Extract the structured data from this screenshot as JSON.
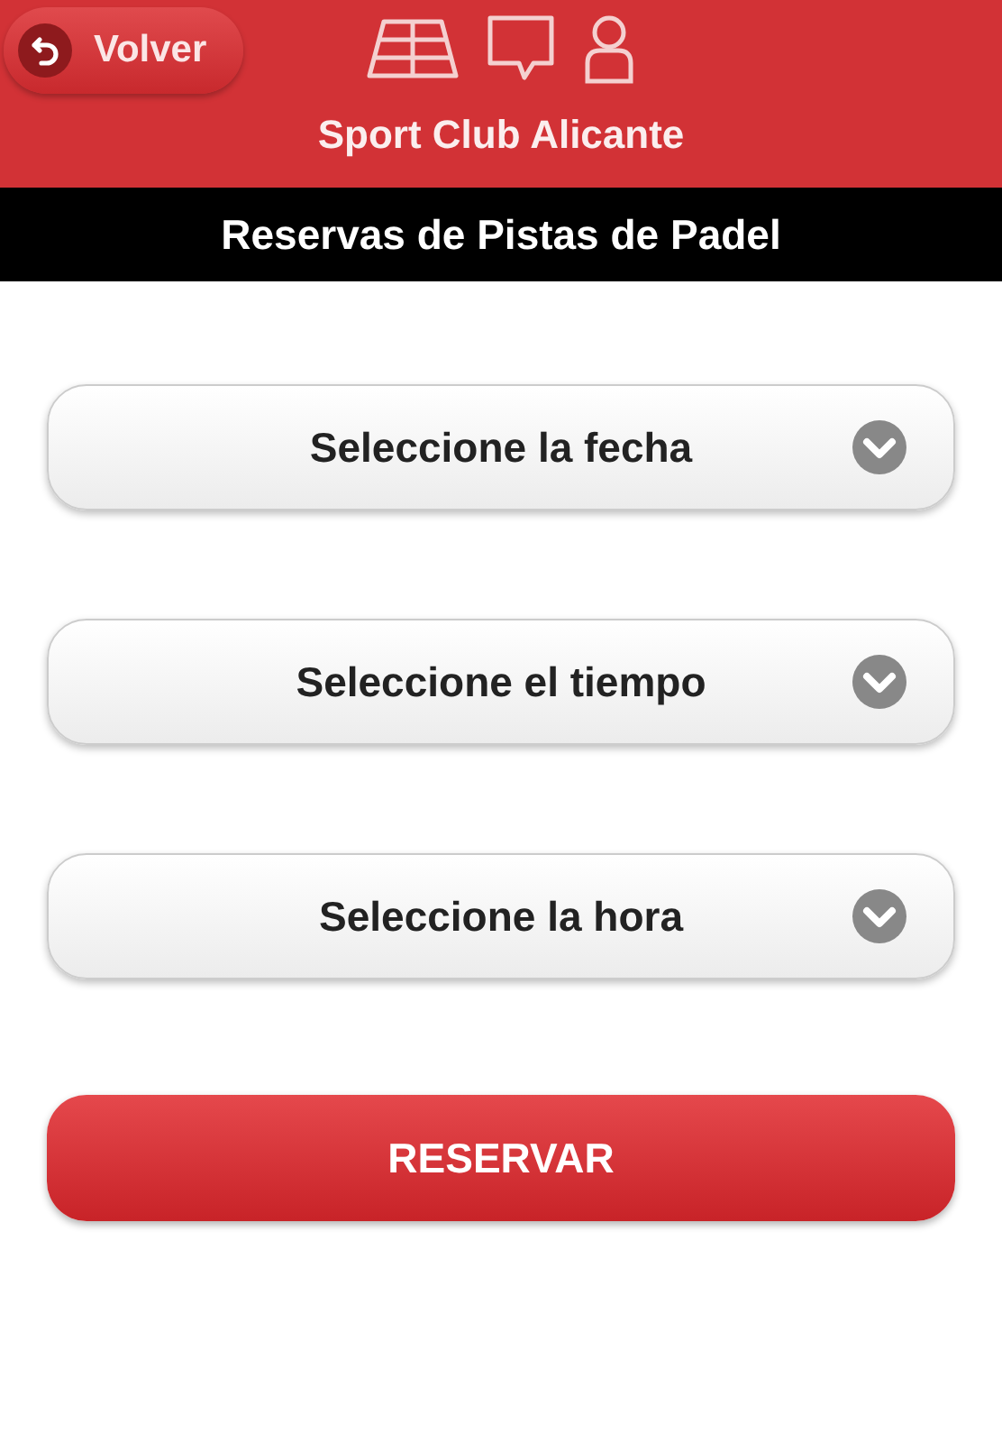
{
  "header": {
    "back_button": "Volver",
    "club_name": "Sport Club Alicante"
  },
  "subtitle": "Reservas de Pistas de Padel",
  "selects": [
    {
      "label": "Seleccione la fecha"
    },
    {
      "label": "Seleccione el tiempo"
    },
    {
      "label": "Seleccione la hora"
    }
  ],
  "submit_button": "RESERVAR"
}
